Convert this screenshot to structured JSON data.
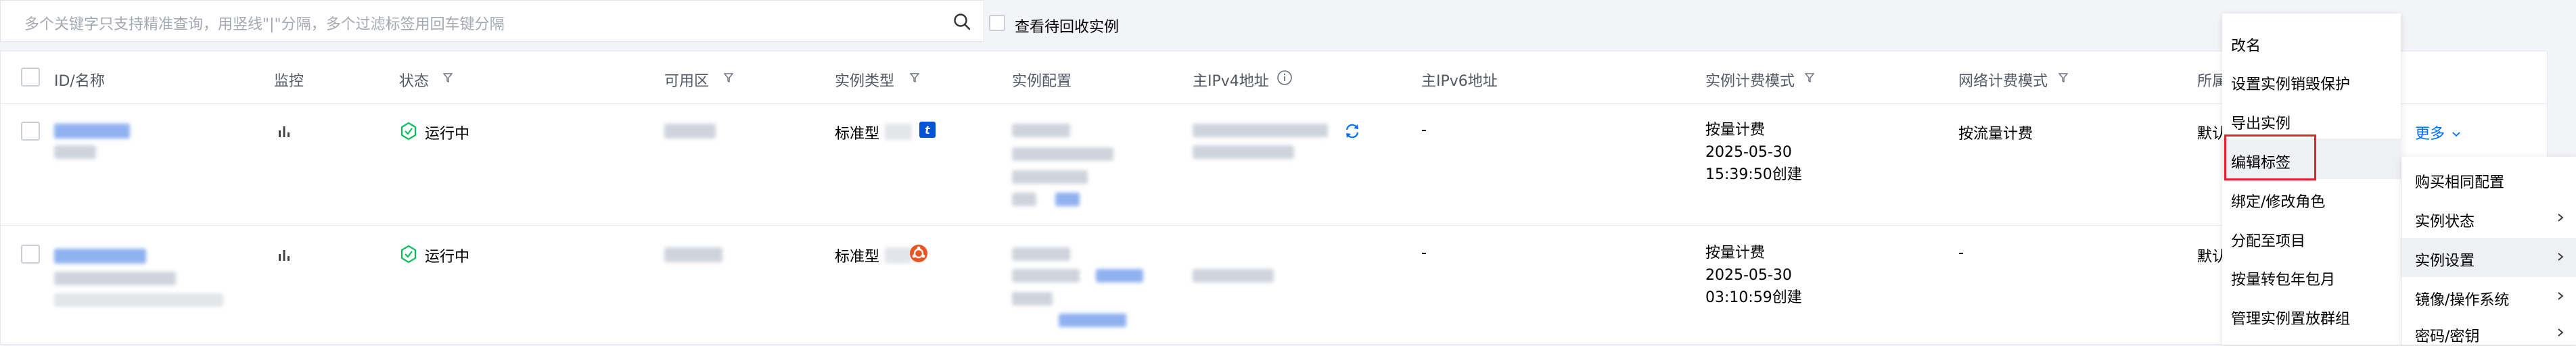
{
  "search": {
    "placeholder": "多个关键字只支持精准查询，用竖线\"|\"分隔，多个过滤标签用回车键分隔",
    "recycle_label": "查看待回收实例"
  },
  "table": {
    "headers": [
      "ID/名称",
      "监控",
      "状态",
      "可用区",
      "实例类型",
      "实例配置",
      "主IPv4地址",
      "主IPv6地址",
      "实例计费模式",
      "网络计费模式",
      "所属"
    ],
    "rows": [
      {
        "status": "运行中",
        "instance_type": "标准型",
        "ipv6": "-",
        "billing_mode": "按量计费",
        "created_date": "2025-05-30",
        "created_time": "15:39:50创建",
        "network_billing": "按流量计费",
        "project": "默认"
      },
      {
        "status": "运行中",
        "instance_type": "标准型",
        "ipv6": "-",
        "billing_mode": "按量计费",
        "created_date": "2025-05-30",
        "created_time": "03:10:59创建",
        "network_billing": "-",
        "project": "默认"
      }
    ],
    "more_label": "更多"
  },
  "menu": {
    "items": [
      "改名",
      "设置实例销毁保护",
      "导出实例",
      "编辑标签",
      "绑定/修改角色",
      "分配至项目",
      "按量转包年包月",
      "管理实例置放群组"
    ]
  },
  "submenu": {
    "items": [
      "购买相同配置",
      "实例状态",
      "实例设置",
      "镜像/操作系统",
      "密码/密钥"
    ]
  },
  "colors": {
    "link": "#006eff",
    "status_running": "#0abf5b",
    "highlight_border": "#e1232d"
  }
}
